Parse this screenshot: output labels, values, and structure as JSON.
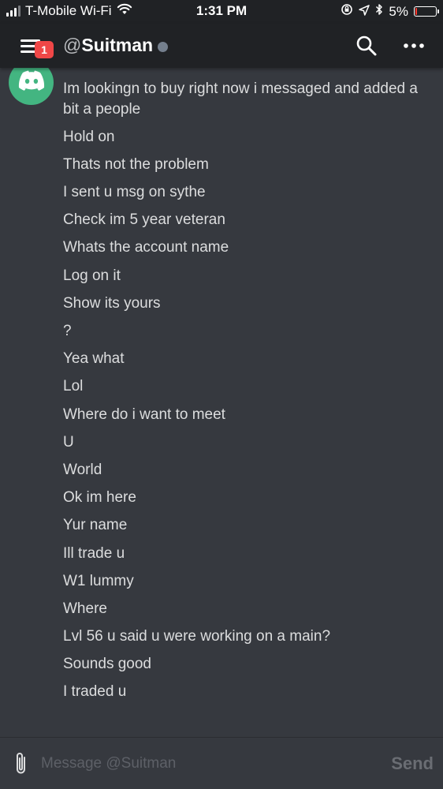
{
  "status_bar": {
    "carrier": "T-Mobile Wi-Fi",
    "time": "1:31 PM",
    "battery": "5%",
    "battery_color": "#ff3b30",
    "icons": [
      "signal-icon",
      "wifi-icon",
      "orientation-lock-icon",
      "location-icon",
      "bluetooth-icon",
      "battery-icon"
    ]
  },
  "header": {
    "badge_count": "1",
    "badge_color": "#f04747",
    "at_symbol": "@",
    "channel_name": "Suitman",
    "presence_color": "#747f8d"
  },
  "colors": {
    "background": "#36393f",
    "header_background": "#202225",
    "avatar": "#43b581"
  },
  "messages": [
    "Im lookingn to buy right now i messaged and added a bit a people",
    "Hold on",
    "Thats not the problem",
    "I sent u msg on sythe",
    "Check im 5 year veteran",
    "Whats the account name",
    "Log on it",
    "Show its yours",
    "?",
    "Yea what",
    "Lol",
    "Where do i want to meet",
    "U",
    "World",
    "Ok im here",
    "Yur name",
    "Ill trade u",
    "W1 lummy",
    "Where",
    "Lvl 56 u said u were working on a main?",
    "Sounds good",
    "I traded u"
  ],
  "composer": {
    "placeholder": "Message @Suitman",
    "send_label": "Send"
  }
}
